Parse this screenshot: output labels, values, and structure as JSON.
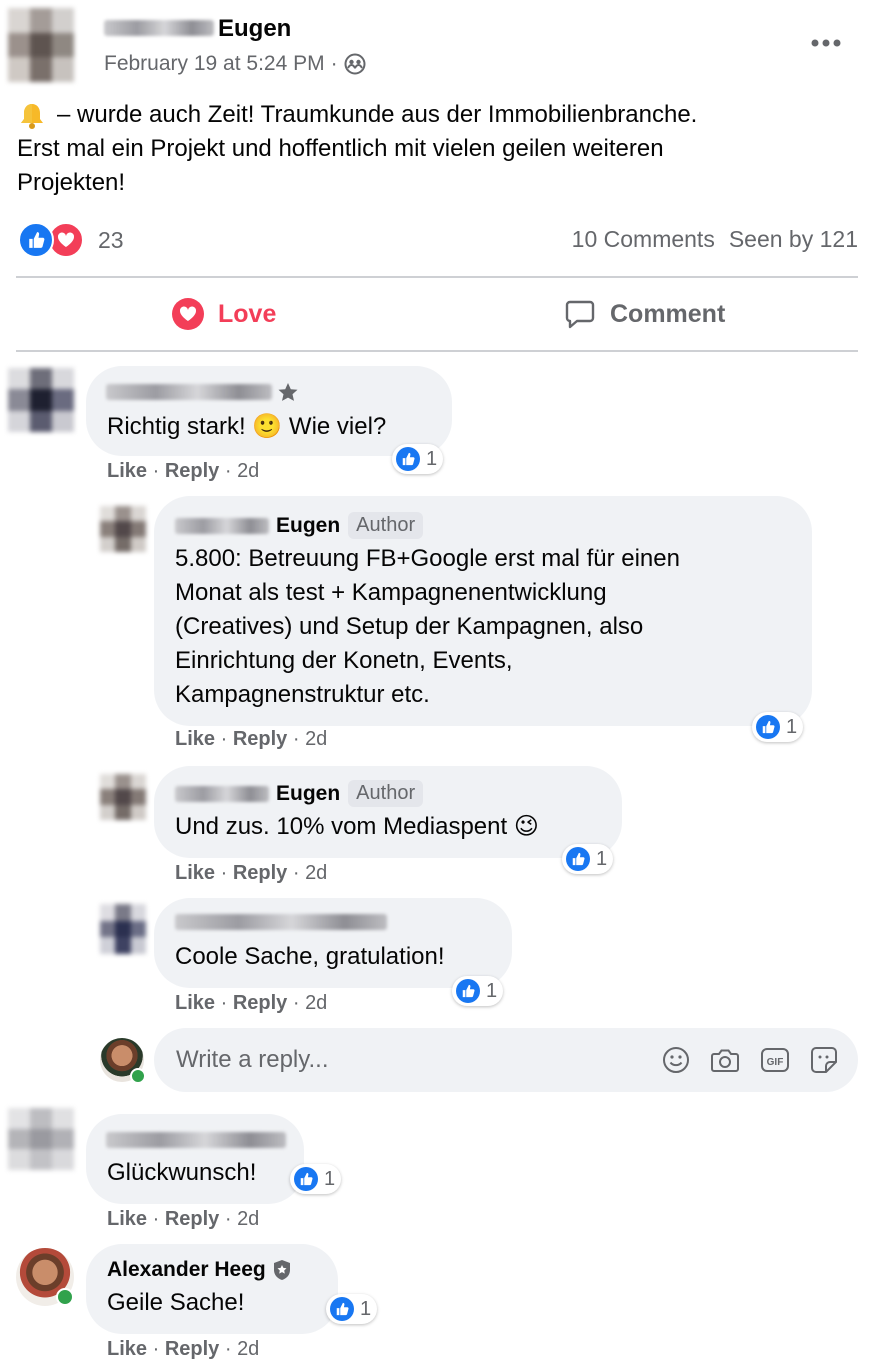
{
  "post": {
    "author_name": "Eugen",
    "timestamp": "February 19 at 5:24 PM",
    "audience_icon": "group-icon",
    "more_icon": "more-dots-icon",
    "text_line1": "– wurde auch Zeit! Traumkunde aus der Immobilienbranche.",
    "text_line2": "Erst mal ein Projekt und hoffentlich mit vielen geilen weiteren",
    "text_line3": "Projekten!",
    "leading_emoji": "bell-icon",
    "reaction_count": "23",
    "comments_count": "10 Comments",
    "seen_by": "Seen by 121",
    "love_label": "Love",
    "comment_label": "Comment"
  },
  "comments": [
    {
      "text": "Richtig stark! 🙂 Wie viel?",
      "like": "Like",
      "reply": "Reply",
      "time": "2d",
      "reactions": "1"
    },
    {
      "name": "Eugen",
      "badge": "Author",
      "text": [
        "5.800: Betreuung FB+Google erst mal für einen",
        "Monat als test + Kampagnenentwicklung",
        "(Creatives) und Setup der Kampagnen, also",
        "Einrichtung der Konetn, Events,",
        "Kampagnenstruktur etc."
      ],
      "like": "Like",
      "reply": "Reply",
      "time": "2d",
      "reactions": "1"
    },
    {
      "name": "Eugen",
      "badge": "Author",
      "text": "Und zus. 10% vom Mediaspent 😉",
      "like": "Like",
      "reply": "Reply",
      "time": "2d",
      "reactions": "1"
    },
    {
      "text": "Coole Sache, gratulation!",
      "like": "Like",
      "reply": "Reply",
      "time": "2d",
      "reactions": "1"
    },
    {
      "text": "Glückwunsch!",
      "like": "Like",
      "reply": "Reply",
      "time": "2d",
      "reactions": "1"
    },
    {
      "name": "Alexander Heeg",
      "text": "Geile Sache!",
      "like": "Like",
      "reply": "Reply",
      "time": "2d",
      "reactions": "1"
    }
  ],
  "reply_box": {
    "placeholder": "Write a reply...",
    "icons": [
      "emoji-icon",
      "camera-icon",
      "gif-icon",
      "sticker-icon"
    ]
  },
  "colors": {
    "like_blue": "#1877f2",
    "love_red": "#f33e58",
    "bubble_bg": "#f0f2f5",
    "meta_gray": "#65676b",
    "online_green": "#31a24c"
  }
}
